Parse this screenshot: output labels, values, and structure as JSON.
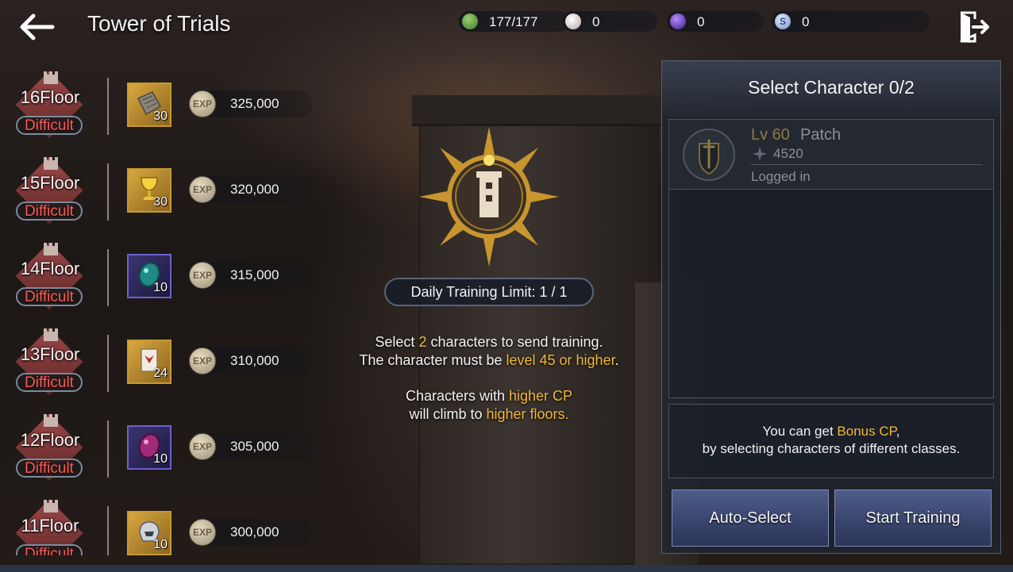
{
  "header": {
    "title": "Tower of Trials",
    "currencies": [
      {
        "icon": "stamina-icon",
        "value": "177/177",
        "color": "#6fb04a"
      },
      {
        "icon": "pearl-icon",
        "value": "0",
        "color": "#e6d6d0"
      },
      {
        "icon": "purple-gem-icon",
        "value": "0",
        "color": "#7a3ad0"
      },
      {
        "icon": "silver-coin-icon",
        "value": "0",
        "color": "#9bb6e0"
      }
    ]
  },
  "floors": [
    {
      "name": "16Floor",
      "difficulty": "Difficult",
      "item_icon": "stone-tablet-icon",
      "item_count": "30",
      "exp": "325,000"
    },
    {
      "name": "15Floor",
      "difficulty": "Difficult",
      "item_icon": "golden-chalice-icon",
      "item_count": "30",
      "exp": "320,000"
    },
    {
      "name": "14Floor",
      "difficulty": "Difficult",
      "item_icon": "teal-gem-icon",
      "item_count": "10",
      "exp": "315,000"
    },
    {
      "name": "13Floor",
      "difficulty": "Difficult",
      "item_icon": "scroll-icon",
      "item_count": "24",
      "exp": "310,000"
    },
    {
      "name": "12Floor",
      "difficulty": "Difficult",
      "item_icon": "magenta-gem-icon",
      "item_count": "10",
      "exp": "305,000"
    },
    {
      "name": "11Floor",
      "difficulty": "Difficult",
      "item_icon": "silver-helmet-icon",
      "item_count": "10",
      "exp": "300,000"
    }
  ],
  "center": {
    "daily_limit": "Daily Training Limit:  1 / 1",
    "line1_a": "Select ",
    "line1_num": "2",
    "line1_b": " characters to send training.",
    "line2_a": "The character must be ",
    "line2_hl": "level 45 or higher",
    "line2_b": ".",
    "line3_a": "Characters with ",
    "line3_hl": "higher CP",
    "line4_a": "will climb to ",
    "line4_hl": "higher floors."
  },
  "panel": {
    "title": "Select Character 0/2",
    "character": {
      "level": "Lv 60",
      "name": "Patch",
      "cp": "4520",
      "status": "Logged in"
    },
    "bonus_a": "You can get  ",
    "bonus_hl": "Bonus CP",
    "bonus_b": ",",
    "bonus_line2": "by selecting characters of different classes.",
    "auto_select": "Auto-Select",
    "start_training": "Start Training"
  },
  "colors": {
    "accent_gold": "#f0b833",
    "difficulty_red": "#ff5a52",
    "button_blue": "#4e5d8a"
  }
}
